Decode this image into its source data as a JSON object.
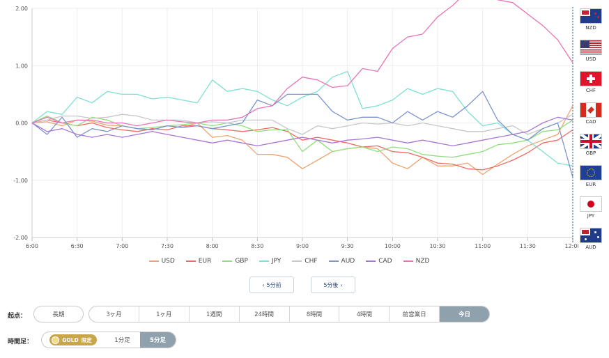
{
  "chart_data": {
    "type": "line",
    "ylim": [
      -2.0,
      2.0
    ],
    "yticks": [
      "2.00",
      "1.00",
      "0.00",
      "-1.00",
      "-2.00"
    ],
    "xticks": [
      "6:00",
      "6:30",
      "7:00",
      "7:30",
      "8:00",
      "8:30",
      "9:00",
      "9:30",
      "10:00",
      "10:30",
      "11:00",
      "11:30",
      "12:00"
    ],
    "grid": true,
    "legend": "bottom",
    "x": [
      "6:00",
      "6:10",
      "6:20",
      "6:30",
      "6:40",
      "6:50",
      "7:00",
      "7:10",
      "7:20",
      "7:30",
      "7:40",
      "7:50",
      "8:00",
      "8:10",
      "8:20",
      "8:30",
      "8:40",
      "8:50",
      "9:00",
      "9:10",
      "9:20",
      "9:30",
      "9:40",
      "9:50",
      "10:00",
      "10:10",
      "10:20",
      "10:30",
      "10:40",
      "10:50",
      "11:00",
      "11:10",
      "11:20",
      "11:30",
      "11:40",
      "11:50",
      "12:00"
    ],
    "series": [
      {
        "name": "USD",
        "color": "#f0a470",
        "values": [
          0.0,
          0.02,
          -0.05,
          0.05,
          0.03,
          -0.04,
          -0.05,
          -0.1,
          -0.12,
          -0.05,
          -0.08,
          0.0,
          -0.25,
          -0.22,
          -0.3,
          -0.55,
          -0.55,
          -0.6,
          -0.8,
          -0.65,
          -0.5,
          -0.45,
          -0.42,
          -0.45,
          -0.7,
          -0.8,
          -0.6,
          -0.75,
          -0.75,
          -0.7,
          -0.9,
          -0.72,
          -0.55,
          -0.4,
          -0.3,
          -0.2,
          0.3
        ]
      },
      {
        "name": "EUR",
        "color": "#ef6a61",
        "values": [
          0.0,
          0.05,
          0.0,
          -0.05,
          0.0,
          -0.08,
          -0.12,
          -0.15,
          -0.1,
          -0.12,
          -0.05,
          -0.05,
          -0.1,
          -0.12,
          -0.15,
          -0.12,
          -0.08,
          -0.15,
          -0.3,
          -0.25,
          -0.3,
          -0.35,
          -0.42,
          -0.4,
          -0.5,
          -0.52,
          -0.6,
          -0.7,
          -0.72,
          -0.8,
          -0.82,
          -0.75,
          -0.65,
          -0.52,
          -0.35,
          -0.3,
          -0.12
        ]
      },
      {
        "name": "GBP",
        "color": "#8ee07a",
        "values": [
          0.0,
          0.12,
          0.0,
          -0.05,
          0.1,
          0.05,
          -0.05,
          -0.1,
          -0.08,
          -0.05,
          -0.03,
          0.0,
          -0.05,
          0.0,
          -0.05,
          -0.15,
          -0.12,
          -0.12,
          -0.5,
          -0.3,
          -0.5,
          -0.45,
          -0.42,
          -0.5,
          -0.42,
          -0.45,
          -0.55,
          -0.58,
          -0.6,
          -0.55,
          -0.5,
          -0.38,
          -0.35,
          -0.3,
          -0.15,
          -0.12,
          0.05
        ]
      },
      {
        "name": "JPY",
        "color": "#7ee0d2",
        "values": [
          0.0,
          0.2,
          0.15,
          0.45,
          0.35,
          0.55,
          0.5,
          0.5,
          0.42,
          0.45,
          0.4,
          0.35,
          0.75,
          0.55,
          0.6,
          0.55,
          0.4,
          0.3,
          0.45,
          0.55,
          0.8,
          0.9,
          0.25,
          0.3,
          0.4,
          0.6,
          0.5,
          0.6,
          0.55,
          0.2,
          -0.05,
          0.0,
          -0.2,
          -0.3,
          -0.5,
          -0.7,
          -0.75
        ]
      },
      {
        "name": "CHF",
        "color": "#c7c7c7",
        "values": [
          0.0,
          0.05,
          0.12,
          0.12,
          0.08,
          0.1,
          0.15,
          0.12,
          0.05,
          0.05,
          0.05,
          0.0,
          0.02,
          0.0,
          0.05,
          0.05,
          0.05,
          -0.1,
          -0.2,
          -0.05,
          -0.1,
          -0.05,
          0.0,
          -0.02,
          0.0,
          -0.05,
          0.0,
          -0.05,
          -0.1,
          -0.15,
          -0.15,
          -0.1,
          -0.05,
          -0.2,
          -0.1,
          0.0,
          0.15
        ]
      },
      {
        "name": "AUD",
        "color": "#7b93d0",
        "values": [
          0.0,
          -0.2,
          0.1,
          -0.25,
          -0.1,
          -0.15,
          -0.05,
          -0.1,
          -0.12,
          -0.05,
          -0.08,
          -0.05,
          -0.1,
          -0.05,
          0.0,
          0.4,
          0.3,
          0.5,
          0.5,
          0.5,
          0.2,
          0.05,
          0.1,
          0.1,
          0.0,
          0.2,
          0.05,
          0.2,
          0.1,
          0.3,
          0.55,
          0.05,
          -0.2,
          -0.3,
          -0.1,
          0.0,
          -0.95
        ]
      },
      {
        "name": "CAD",
        "color": "#a877d8",
        "values": [
          0.0,
          -0.15,
          -0.1,
          -0.2,
          -0.25,
          -0.2,
          -0.25,
          -0.2,
          -0.15,
          -0.2,
          -0.25,
          -0.3,
          -0.35,
          -0.3,
          -0.35,
          -0.4,
          -0.35,
          -0.3,
          -0.25,
          -0.3,
          -0.35,
          -0.3,
          -0.28,
          -0.25,
          -0.3,
          -0.35,
          -0.3,
          -0.35,
          -0.4,
          -0.35,
          -0.3,
          -0.25,
          -0.2,
          -0.15,
          0.0,
          0.1,
          0.05
        ]
      },
      {
        "name": "NZD",
        "color": "#e874b5",
        "values": [
          0.0,
          0.1,
          0.0,
          0.05,
          0.05,
          0.0,
          0.0,
          -0.05,
          0.0,
          0.05,
          0.02,
          0.0,
          0.05,
          0.05,
          0.1,
          0.25,
          0.3,
          0.6,
          0.8,
          0.75,
          0.62,
          0.65,
          0.95,
          0.9,
          1.3,
          1.5,
          1.55,
          1.85,
          2.05,
          2.3,
          2.4,
          2.15,
          2.1,
          1.9,
          1.7,
          1.45,
          1.05
        ]
      }
    ]
  },
  "flags": [
    {
      "code": "NZD"
    },
    {
      "code": "USD"
    },
    {
      "code": "CHF"
    },
    {
      "code": "CAD"
    },
    {
      "code": "GBP"
    },
    {
      "code": "EUR"
    },
    {
      "code": "JPY"
    },
    {
      "code": "AUD"
    }
  ],
  "nav": {
    "prev_label": "5分前",
    "next_label": "5分後"
  },
  "start_point": {
    "label": "起点：",
    "long_term": "長期",
    "options": [
      "3ヶ月",
      "1ヶ月",
      "1週間",
      "24時間",
      "8時間",
      "4時間",
      "前営業日",
      "今日"
    ],
    "active": "今日"
  },
  "timeframe": {
    "label": "時間足：",
    "gold_label": "GOLD",
    "gold_limited": "限定",
    "options": [
      "1分足",
      "5分足"
    ],
    "active": "5分足"
  }
}
